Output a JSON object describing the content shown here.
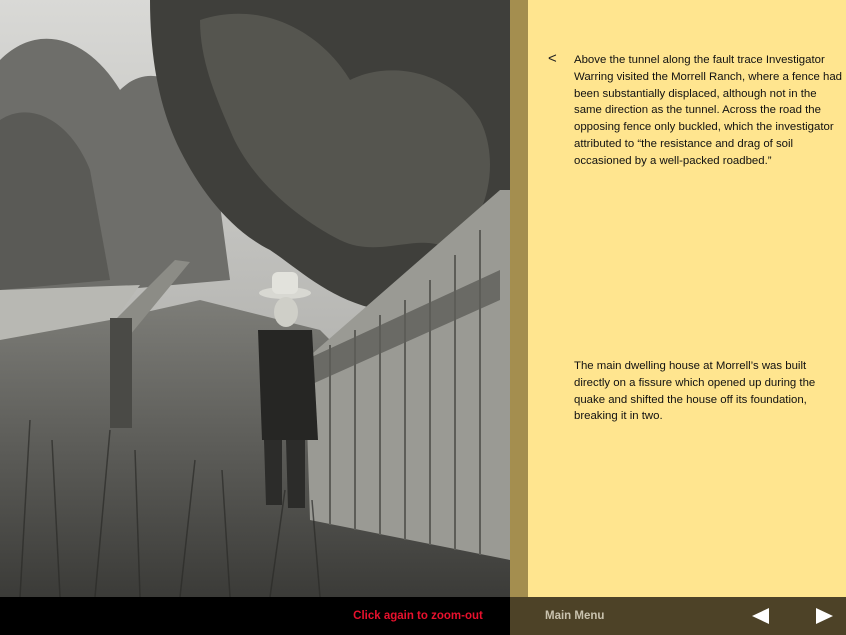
{
  "photo": {
    "subject": "historic-photo-fence"
  },
  "panel": {
    "back_label": "<",
    "paragraph_1": "Above the tunnel along the fault trace Investigator Warring visited the Morrell Ranch, where a fence had been substantially displaced, although not in the same direction as the tunnel. Across the road the opposing fence only buckled, which the investigator attributed to “the resistance and drag of soil occasioned by a well-packed roadbed.”",
    "paragraph_2": "The main dwelling house at Morrell’s was built directly on a fissure which opened up during the quake and shifted the house off its foundation, breaking it in two."
  },
  "bottom": {
    "zoom_note": "Click again to zoom-out",
    "main_menu": "Main Menu",
    "prev_icon": "triangle-left-icon",
    "next_icon": "triangle-right-icon"
  },
  "colors": {
    "panel_bg": "#ffe58f",
    "divider": "#a48e4f",
    "nav_bar": "#4d4227",
    "zoom_note_text": "#e8112d"
  }
}
